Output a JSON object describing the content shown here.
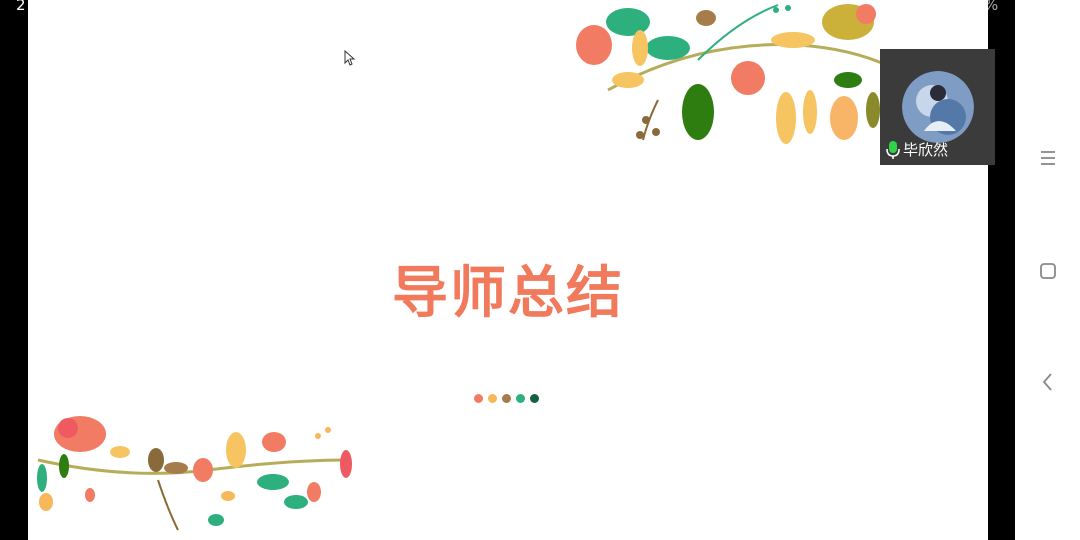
{
  "status_bar": {
    "time_fragment": "2",
    "battery_fragment": "%"
  },
  "slide": {
    "title": "导师总结",
    "dot_colors": [
      "#f27b64",
      "#f6b85a",
      "#a67c4a",
      "#2db07d",
      "#13623f"
    ]
  },
  "participant": {
    "name": "毕欣然",
    "mic_icon": "mic-icon"
  },
  "nav_bar": {
    "icons": [
      "menu-icon",
      "home-square-icon",
      "back-chevron-icon"
    ]
  }
}
